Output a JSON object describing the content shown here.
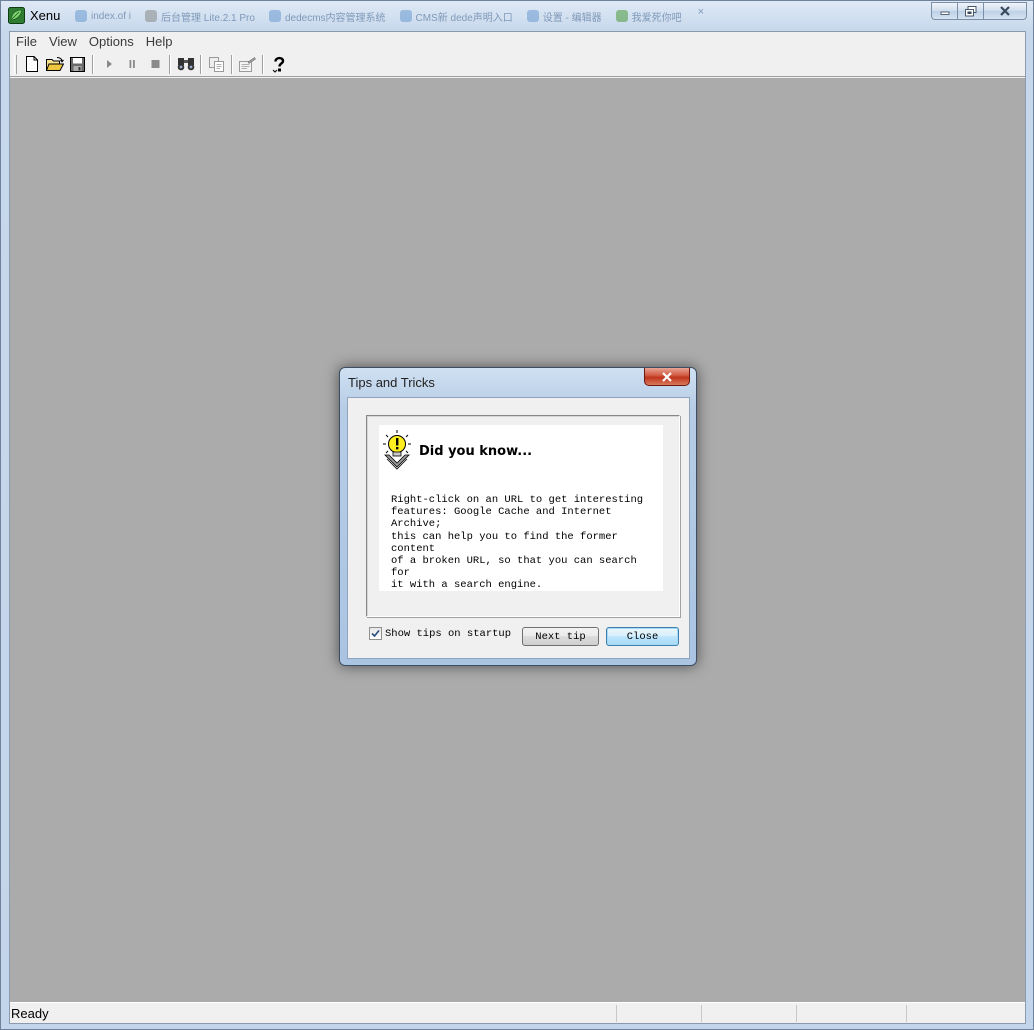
{
  "window": {
    "title": "Xenu",
    "background_tabs": [
      {
        "label": "index.of i",
        "icon": "globe-icon"
      },
      {
        "label": "后台管理 Lite.2.1 Pro",
        "icon": "page-icon"
      },
      {
        "label": "dedecms内容管理系统",
        "icon": "globe-icon"
      },
      {
        "label": "CMS新 dede声明入口",
        "icon": "globe-icon"
      },
      {
        "label": "设置 - 编辑器",
        "icon": "page-icon"
      },
      {
        "label": "我爱死你吧",
        "icon": "leaf-icon"
      }
    ],
    "tab_close_glyph": "×"
  },
  "menu": {
    "items": [
      "File",
      "View",
      "Options",
      "Help"
    ]
  },
  "toolbar": {
    "buttons": [
      "new-document-icon",
      "open-folder-icon",
      "save-icon",
      "play-icon",
      "pause-icon",
      "stop-icon",
      "find-binoculars-icon",
      "copy-icon",
      "properties-icon",
      "help-icon"
    ]
  },
  "status": {
    "text": "Ready"
  },
  "dialog": {
    "title": "Tips and Tricks",
    "heading": "Did you know...",
    "tip_text": "Right-click on an URL to get interesting\nfeatures: Google Cache and Internet Archive;\nthis can help you to find the former content\nof a broken URL, so that you can search for\nit with a search engine.",
    "show_tips_label": "Show tips on startup",
    "show_tips_checked": true,
    "next_tip_label": "Next tip",
    "close_label": "Close"
  },
  "colors": {
    "workspace": "#ababab",
    "chrome": "#f0f0f0",
    "close_red": "#c0341d",
    "default_button_border": "#3c7fb1"
  }
}
